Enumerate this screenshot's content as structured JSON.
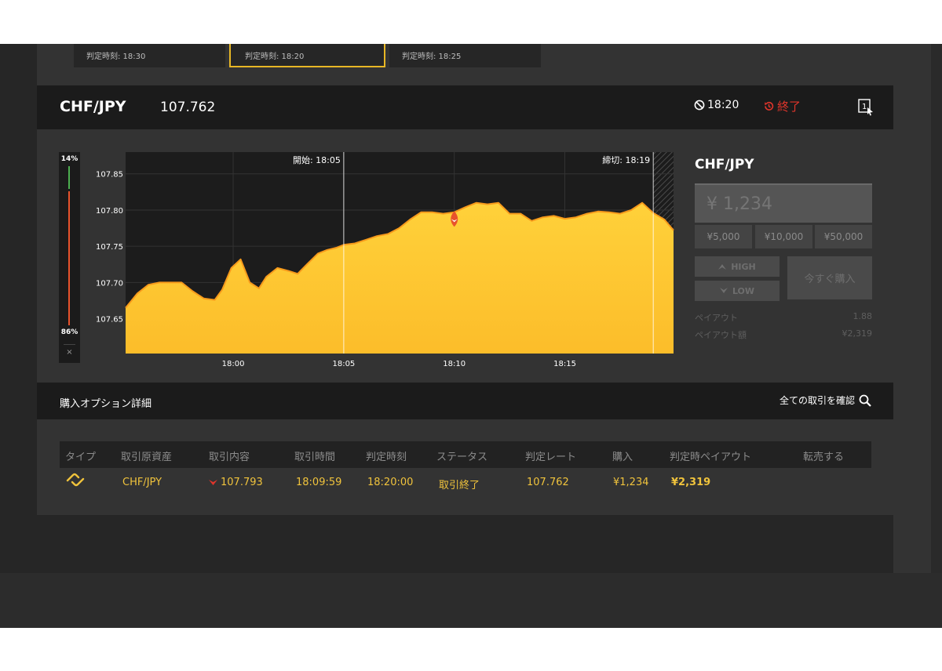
{
  "expiry_cards": [
    {
      "label": "判定時刻: 18:30",
      "selected": false
    },
    {
      "label": "判定時刻: 18:20",
      "selected": true
    },
    {
      "label": "判定時刻: 18:25",
      "selected": false
    }
  ],
  "asset_header": {
    "asset": "CHF/JPY",
    "rate": "107.762",
    "expiry_time": "18:20",
    "status": "終了"
  },
  "probability": {
    "high": "14%",
    "low": "86%",
    "high_value": 0.14,
    "low_value": 0.86,
    "close": "×"
  },
  "chart_data": {
    "type": "area",
    "y_ticks": [
      "107.85",
      "107.80",
      "107.75",
      "107.70",
      "107.65"
    ],
    "x_ticks": [
      "18:00",
      "18:05",
      "18:10",
      "18:15"
    ],
    "ylim": [
      107.602,
      107.88
    ],
    "xlim": [
      "17:55:08",
      "18:19:55"
    ],
    "start_label": "開始: 18:05",
    "end_label": "締切: 18:19",
    "start_time": "18:05",
    "end_time": "18:19",
    "entry_marker": {
      "time": "18:10",
      "value": 107.793,
      "direction": "LOW"
    },
    "series": [
      {
        "x": [
          "17:55:08",
          "17:55:40",
          "17:56:10",
          "17:56:40",
          "17:57:10",
          "17:57:40",
          "17:58:10",
          "17:58:40",
          "17:59:10",
          "17:59:30",
          "17:59:55",
          "18:00:20",
          "18:00:45",
          "18:01:10",
          "18:01:30",
          "18:02:00",
          "18:02:30",
          "18:02:55",
          "18:03:20",
          "18:03:50",
          "18:04:15",
          "18:04:40",
          "18:05:00",
          "18:05:30",
          "18:06:00",
          "18:06:30",
          "18:07:00",
          "18:07:30",
          "18:08:00",
          "18:08:30",
          "18:09:00",
          "18:09:30",
          "18:10:00",
          "18:10:30",
          "18:11:00",
          "18:11:30",
          "18:12:00",
          "18:12:30",
          "18:13:00",
          "18:13:30",
          "18:14:00",
          "18:14:30",
          "18:15:00",
          "18:15:30",
          "18:16:00",
          "18:16:30",
          "18:17:00",
          "18:17:30",
          "18:18:00",
          "18:18:30",
          "18:19:00",
          "18:19:30",
          "18:19:55"
        ],
        "values": [
          107.665,
          107.685,
          107.697,
          107.7,
          107.7,
          107.7,
          107.688,
          107.678,
          107.676,
          107.69,
          107.72,
          107.732,
          107.7,
          107.692,
          107.708,
          107.72,
          107.716,
          107.712,
          107.725,
          107.74,
          107.745,
          107.748,
          107.752,
          107.754,
          107.759,
          107.764,
          107.767,
          107.775,
          107.787,
          107.797,
          107.797,
          107.795,
          107.797,
          107.804,
          107.81,
          107.808,
          107.81,
          107.795,
          107.795,
          107.785,
          107.79,
          107.792,
          107.788,
          107.79,
          107.795,
          107.798,
          107.797,
          107.795,
          107.8,
          107.81,
          107.796,
          107.787,
          107.772
        ]
      }
    ]
  },
  "trade_panel": {
    "asset": "CHF/JPY",
    "amount_placeholder": "¥ 1,234",
    "presets": [
      "¥5,000",
      "¥10,000",
      "¥50,000"
    ],
    "high_label": "HIGH",
    "low_label": "LOW",
    "buy_now_label": "今すぐ購入",
    "payout_label": "ペイアウト",
    "payout_value": "1.88",
    "payout_amount_label": "ペイアウト額",
    "payout_amount_value": "¥2,319"
  },
  "details": {
    "title": "購入オプション詳細",
    "view_all": "全ての取引を確認"
  },
  "table": {
    "headers": [
      "タイプ",
      "取引原資産",
      "取引内容",
      "取引時間",
      "判定時刻",
      "ステータス",
      "判定レート",
      "購入",
      "判定時ペイアウト",
      "転売する"
    ],
    "rows": [
      {
        "asset": "CHF/JPY",
        "direction": "LOW",
        "entry_rate": "107.793",
        "time": "18:09:59",
        "expiry": "18:20:00",
        "status": "取引終了",
        "closing_rate": "107.762",
        "purchase": "¥1,234",
        "payout": "¥2,319"
      }
    ]
  },
  "colors": {
    "accent": "#f0c33c",
    "chart_fill_top": "#ffd13a",
    "chart_line": "#f79a1b",
    "status_red": "#e0352b",
    "high_green": "#4caf50",
    "low_red": "#e8532c"
  }
}
